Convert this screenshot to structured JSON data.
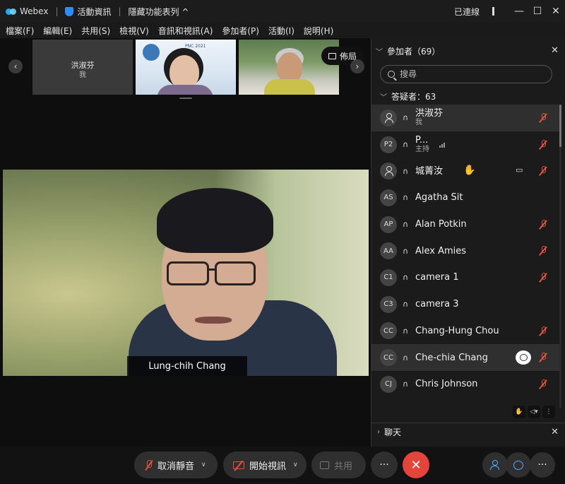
{
  "titlebar": {
    "app_name": "Webex",
    "meeting_info": "活動資訊",
    "hide_features": "隱藏功能表列 ^",
    "connection": "已連線",
    "separator": "|"
  },
  "menu": {
    "items": [
      {
        "label": "檔案(F)"
      },
      {
        "label": "編輯(E)"
      },
      {
        "label": "共用(S)"
      },
      {
        "label": "檢視(V)"
      },
      {
        "label": "音訊和視訊(A)"
      },
      {
        "label": "參加者(P)"
      },
      {
        "label": "活動(I)"
      },
      {
        "label": "說明(H)"
      }
    ]
  },
  "stage": {
    "layout_button": "佈局",
    "thumbnails": [
      {
        "name": "洪淑芬",
        "sub": "我"
      }
    ],
    "main_speaker": "Lung-chih Chang",
    "poster_text": "PNC 2021"
  },
  "panel": {
    "title": "參加者（69）",
    "search_placeholder": "搜尋",
    "group_title": "答疑者：63",
    "participants": [
      {
        "initials": "",
        "name": "洪淑芬",
        "sub": "我",
        "selected": true
      },
      {
        "initials": "P2",
        "name": "P...",
        "sub": "主持"
      },
      {
        "initials": "",
        "name": "城菁汝"
      },
      {
        "initials": "AS",
        "name": "Agatha Sit"
      },
      {
        "initials": "AP",
        "name": "Alan Potkin"
      },
      {
        "initials": "AA",
        "name": "Alex Amies"
      },
      {
        "initials": "C1",
        "name": "camera 1"
      },
      {
        "initials": "C3",
        "name": "camera 3"
      },
      {
        "initials": "CC",
        "name": "Chang-Hung Chou"
      },
      {
        "initials": "CC",
        "name": "Che-chia Chang",
        "selected": true
      },
      {
        "initials": "CJ",
        "name": "Chris Johnson"
      }
    ],
    "chat_title": "聊天"
  },
  "controls": {
    "unmute": "取消靜音",
    "start_video": "開始視訊",
    "share": "共用",
    "more": "···",
    "end": "✕"
  },
  "colors": {
    "accent_blue": "#5aa9ff",
    "end_red": "#e5443a",
    "muted_red": "#e5533d"
  }
}
